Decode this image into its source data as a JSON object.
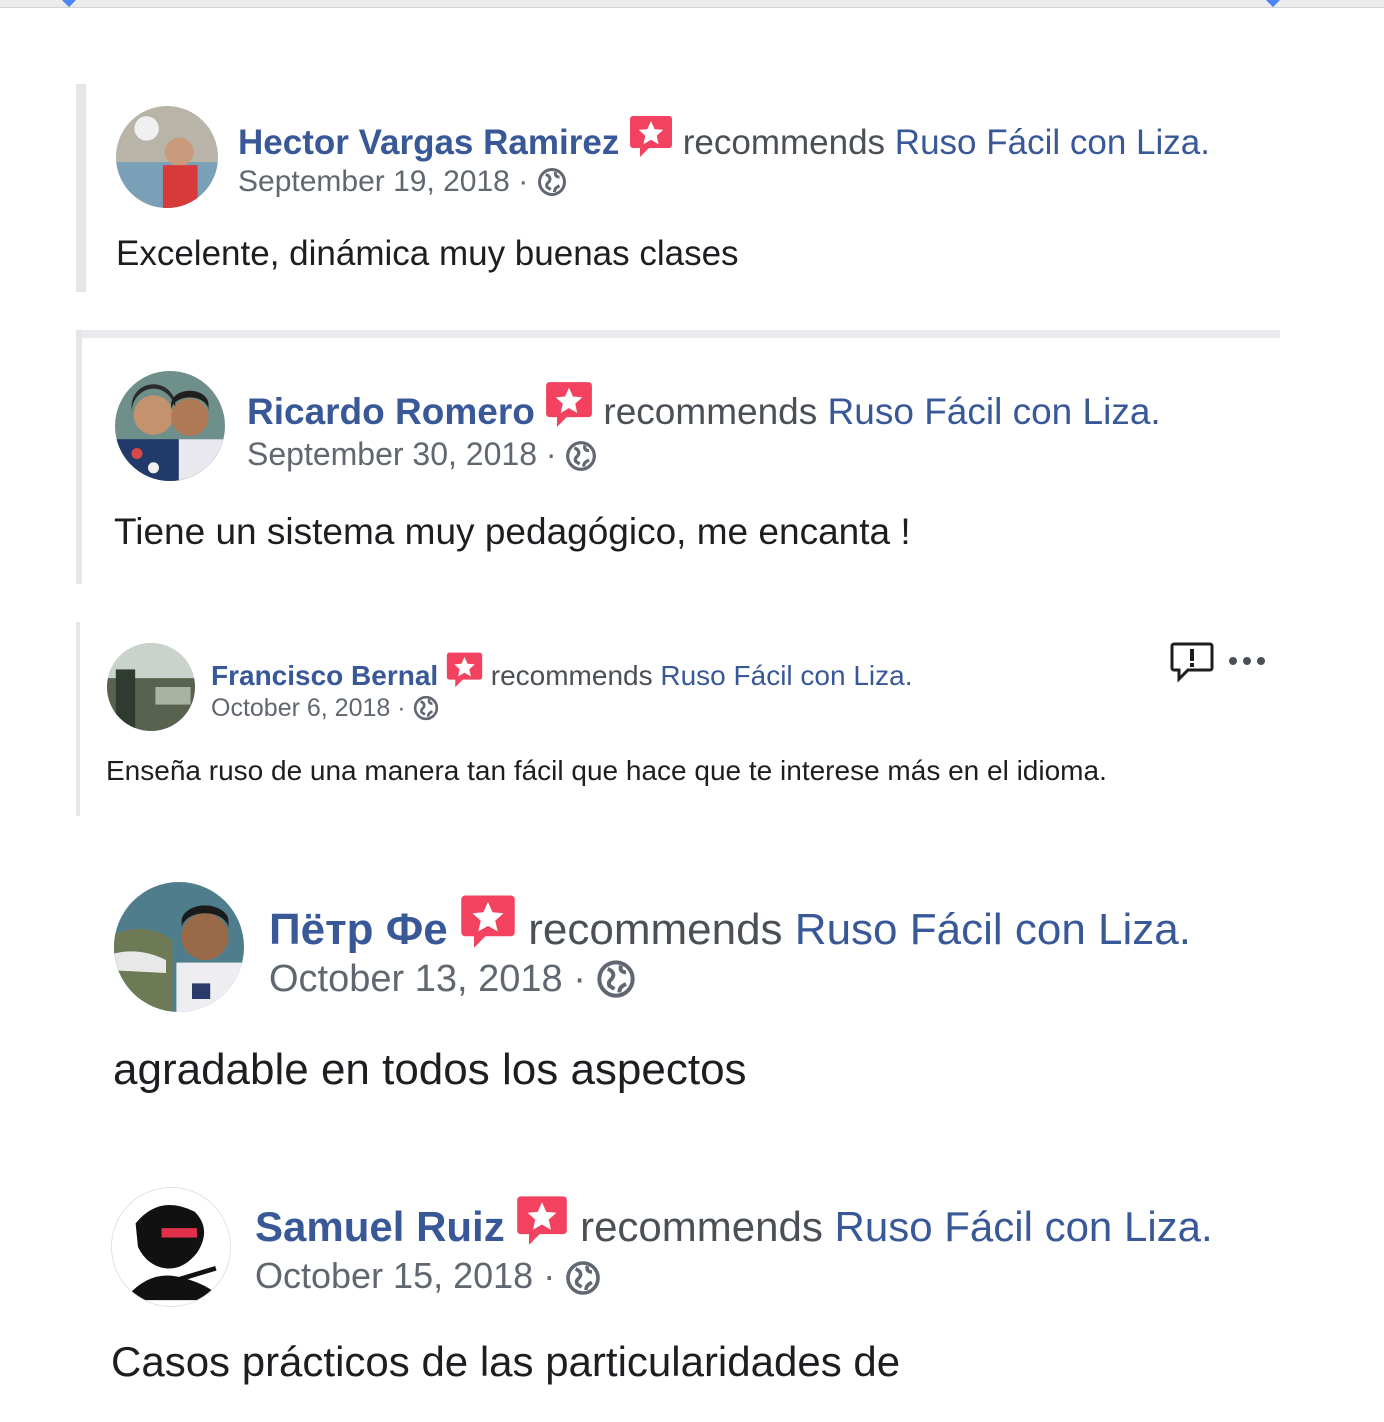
{
  "reviews": [
    {
      "author": "Hector Vargas Ramirez",
      "action": "recommends",
      "page": "Ruso Fácil con Liza.",
      "date": "September 19, 2018",
      "separator": "·",
      "text": "Excelente, dinámica muy buenas clases",
      "icons": {
        "recommend": "recommend-star-icon",
        "privacy": "globe-icon"
      }
    },
    {
      "author": "Ricardo Romero",
      "action": "recommends",
      "page": "Ruso Fácil con Liza.",
      "date": "September 30, 2018",
      "separator": "·",
      "text": "Tiene un sistema muy pedagógico, me encanta !",
      "icons": {
        "recommend": "recommend-star-icon",
        "privacy": "globe-icon"
      }
    },
    {
      "author": "Francisco Bernal",
      "action": "recommends",
      "page": "Ruso Fácil con Liza.",
      "date": "October 6, 2018",
      "separator": "·",
      "text": "Enseña ruso de una manera tan fácil que hace que te interese más en el idioma.",
      "icons": {
        "recommend": "recommend-star-icon",
        "privacy": "globe-icon",
        "report": "report-icon",
        "more": "more-options-icon"
      }
    },
    {
      "author": "Пётр Фе",
      "action": "recommends",
      "page": "Ruso Fácil con Liza.",
      "date": "October 13, 2018",
      "separator": "·",
      "text": "agradable en todos los aspectos",
      "icons": {
        "recommend": "recommend-star-icon",
        "privacy": "globe-icon"
      }
    },
    {
      "author": "Samuel Ruiz",
      "action": "recommends",
      "page": "Ruso Fácil con Liza.",
      "date": "October 15, 2018",
      "separator": "·",
      "text": "Casos prácticos de las particularidades de",
      "icons": {
        "recommend": "recommend-star-icon",
        "privacy": "globe-icon"
      }
    }
  ],
  "colors": {
    "author_link": "#385898",
    "secondary_text": "#616770",
    "recommend_badge": "#f3425f",
    "card_border": "#dadde1"
  }
}
